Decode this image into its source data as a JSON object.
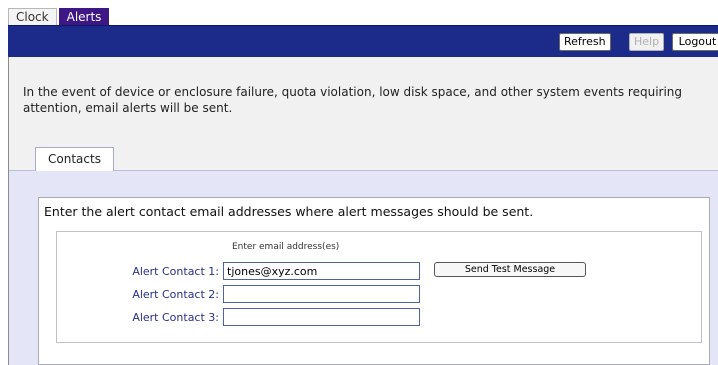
{
  "tabs": [
    {
      "label": "Clock",
      "active": false
    },
    {
      "label": "Alerts",
      "active": true
    }
  ],
  "toolbar": {
    "refresh_label": "Refresh",
    "help_label": "Help",
    "help_enabled": false,
    "logout_label": "Logout"
  },
  "intro_text": "In the event of device or enclosure failure, quota violation, low disk space, and other system events requiring attention, email alerts will be sent.",
  "section_tab": "Contacts",
  "panel": {
    "heading": "Enter the alert contact email addresses where alert messages should be sent.",
    "email_hint": "Enter email address(es)",
    "contacts": [
      {
        "label": "Alert Contact 1:",
        "value": "tjones@xyz.com"
      },
      {
        "label": "Alert Contact 2:",
        "value": ""
      },
      {
        "label": "Alert Contact 3:",
        "value": ""
      }
    ],
    "send_test_label": "Send Test Message"
  },
  "colors": {
    "header_bar": "#1c2a8a",
    "active_tab": "#3c1785",
    "panel_tint": "#e5e5f8",
    "label_text": "#2a2f8a"
  }
}
